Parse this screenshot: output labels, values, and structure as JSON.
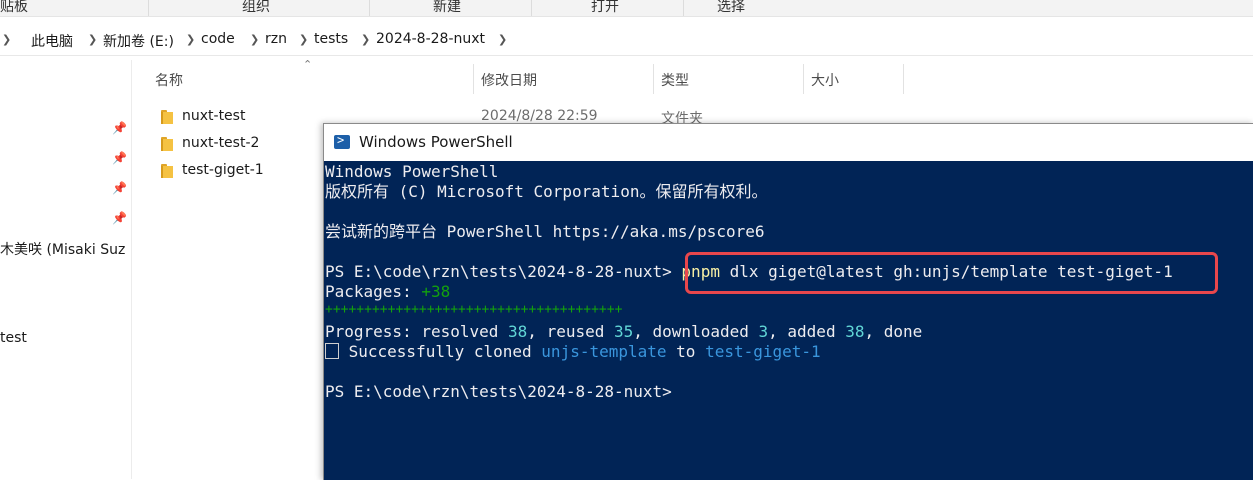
{
  "ribbon": {
    "groups": [
      "贴板",
      "组织",
      "新建",
      "打开",
      "选择"
    ]
  },
  "address_bar": {
    "crumbs": [
      "此电脑",
      "新加卷 (E:)",
      "code",
      "rzn",
      "tests",
      "2024-8-28-nuxt"
    ]
  },
  "nav_pane": {
    "items": [
      "木美咲 (Misaki Suz",
      "test"
    ]
  },
  "file_list": {
    "columns": [
      "名称",
      "修改日期",
      "类型",
      "大小"
    ],
    "rows": [
      {
        "name": "nuxt-test",
        "date": "2024/8/28 22:59",
        "type": "文件夹"
      },
      {
        "name": "nuxt-test-2"
      },
      {
        "name": "test-giget-1"
      }
    ]
  },
  "powershell": {
    "title": "Windows PowerShell",
    "lines": {
      "l1": "Windows PowerShell",
      "l2": "版权所有 (C) Microsoft Corporation。保留所有权利。",
      "l3": "尝试新的跨平台 PowerShell https://aka.ms/pscore6",
      "prompt": "PS E:\\code\\rzn\\tests\\2024-8-28-nuxt>",
      "cmd_pnpm": "pnpm",
      "cmd_rest": " dlx giget@latest gh:unjs/template test-giget-1",
      "packages_label": "Packages: ",
      "packages_count": "+38",
      "progress_bar": "++++++++++++++++++++++++++++++++++++++",
      "progress_prefix": "Progress: resolved ",
      "resolved": "38",
      "reused_label": ", reused ",
      "reused": "35",
      "downloaded_label": ", downloaded ",
      "downloaded": "3",
      "added_label": ", added ",
      "added": "38",
      "done": ", done",
      "success_prefix": " Successfully cloned ",
      "repo": "unjs-template",
      "to": " to ",
      "target": "test-giget-1",
      "prompt2": "PS E:\\code\\rzn\\tests\\2024-8-28-nuxt>"
    }
  },
  "colors": {
    "console_bg": "#012456",
    "highlight_border": "#e8474c"
  }
}
